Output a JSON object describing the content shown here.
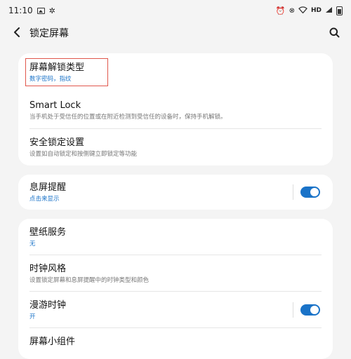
{
  "status": {
    "time": "11:10",
    "right_text": "HD"
  },
  "header": {
    "title": "锁定屏幕"
  },
  "card1": {
    "items": [
      {
        "title": "屏幕解锁类型",
        "subtitle": "数字密码，指纹"
      },
      {
        "title": "Smart Lock",
        "subtitle": "当手机处于受信任的位置或在附近检测到受信任的设备时，保持手机解锁。"
      },
      {
        "title": "安全锁定设置",
        "subtitle": "设置如自动锁定和按侧键立即锁定等功能"
      }
    ]
  },
  "card2": {
    "items": [
      {
        "title": "息屏提醒",
        "subtitle": "点击来显示",
        "toggle_on": true
      }
    ]
  },
  "card3": {
    "items": [
      {
        "title": "壁纸服务",
        "subtitle": "无"
      },
      {
        "title": "时钟风格",
        "subtitle": "设置锁定屏幕和息屏提醒中的时钟类型和颜色"
      },
      {
        "title": "漫游时钟",
        "subtitle": "开",
        "toggle_on": true
      },
      {
        "title": "屏幕小组件",
        "subtitle": ""
      }
    ]
  },
  "colors": {
    "accent": "#1a73c8",
    "highlight": "#e0574c",
    "background": "#f4f4f4"
  }
}
